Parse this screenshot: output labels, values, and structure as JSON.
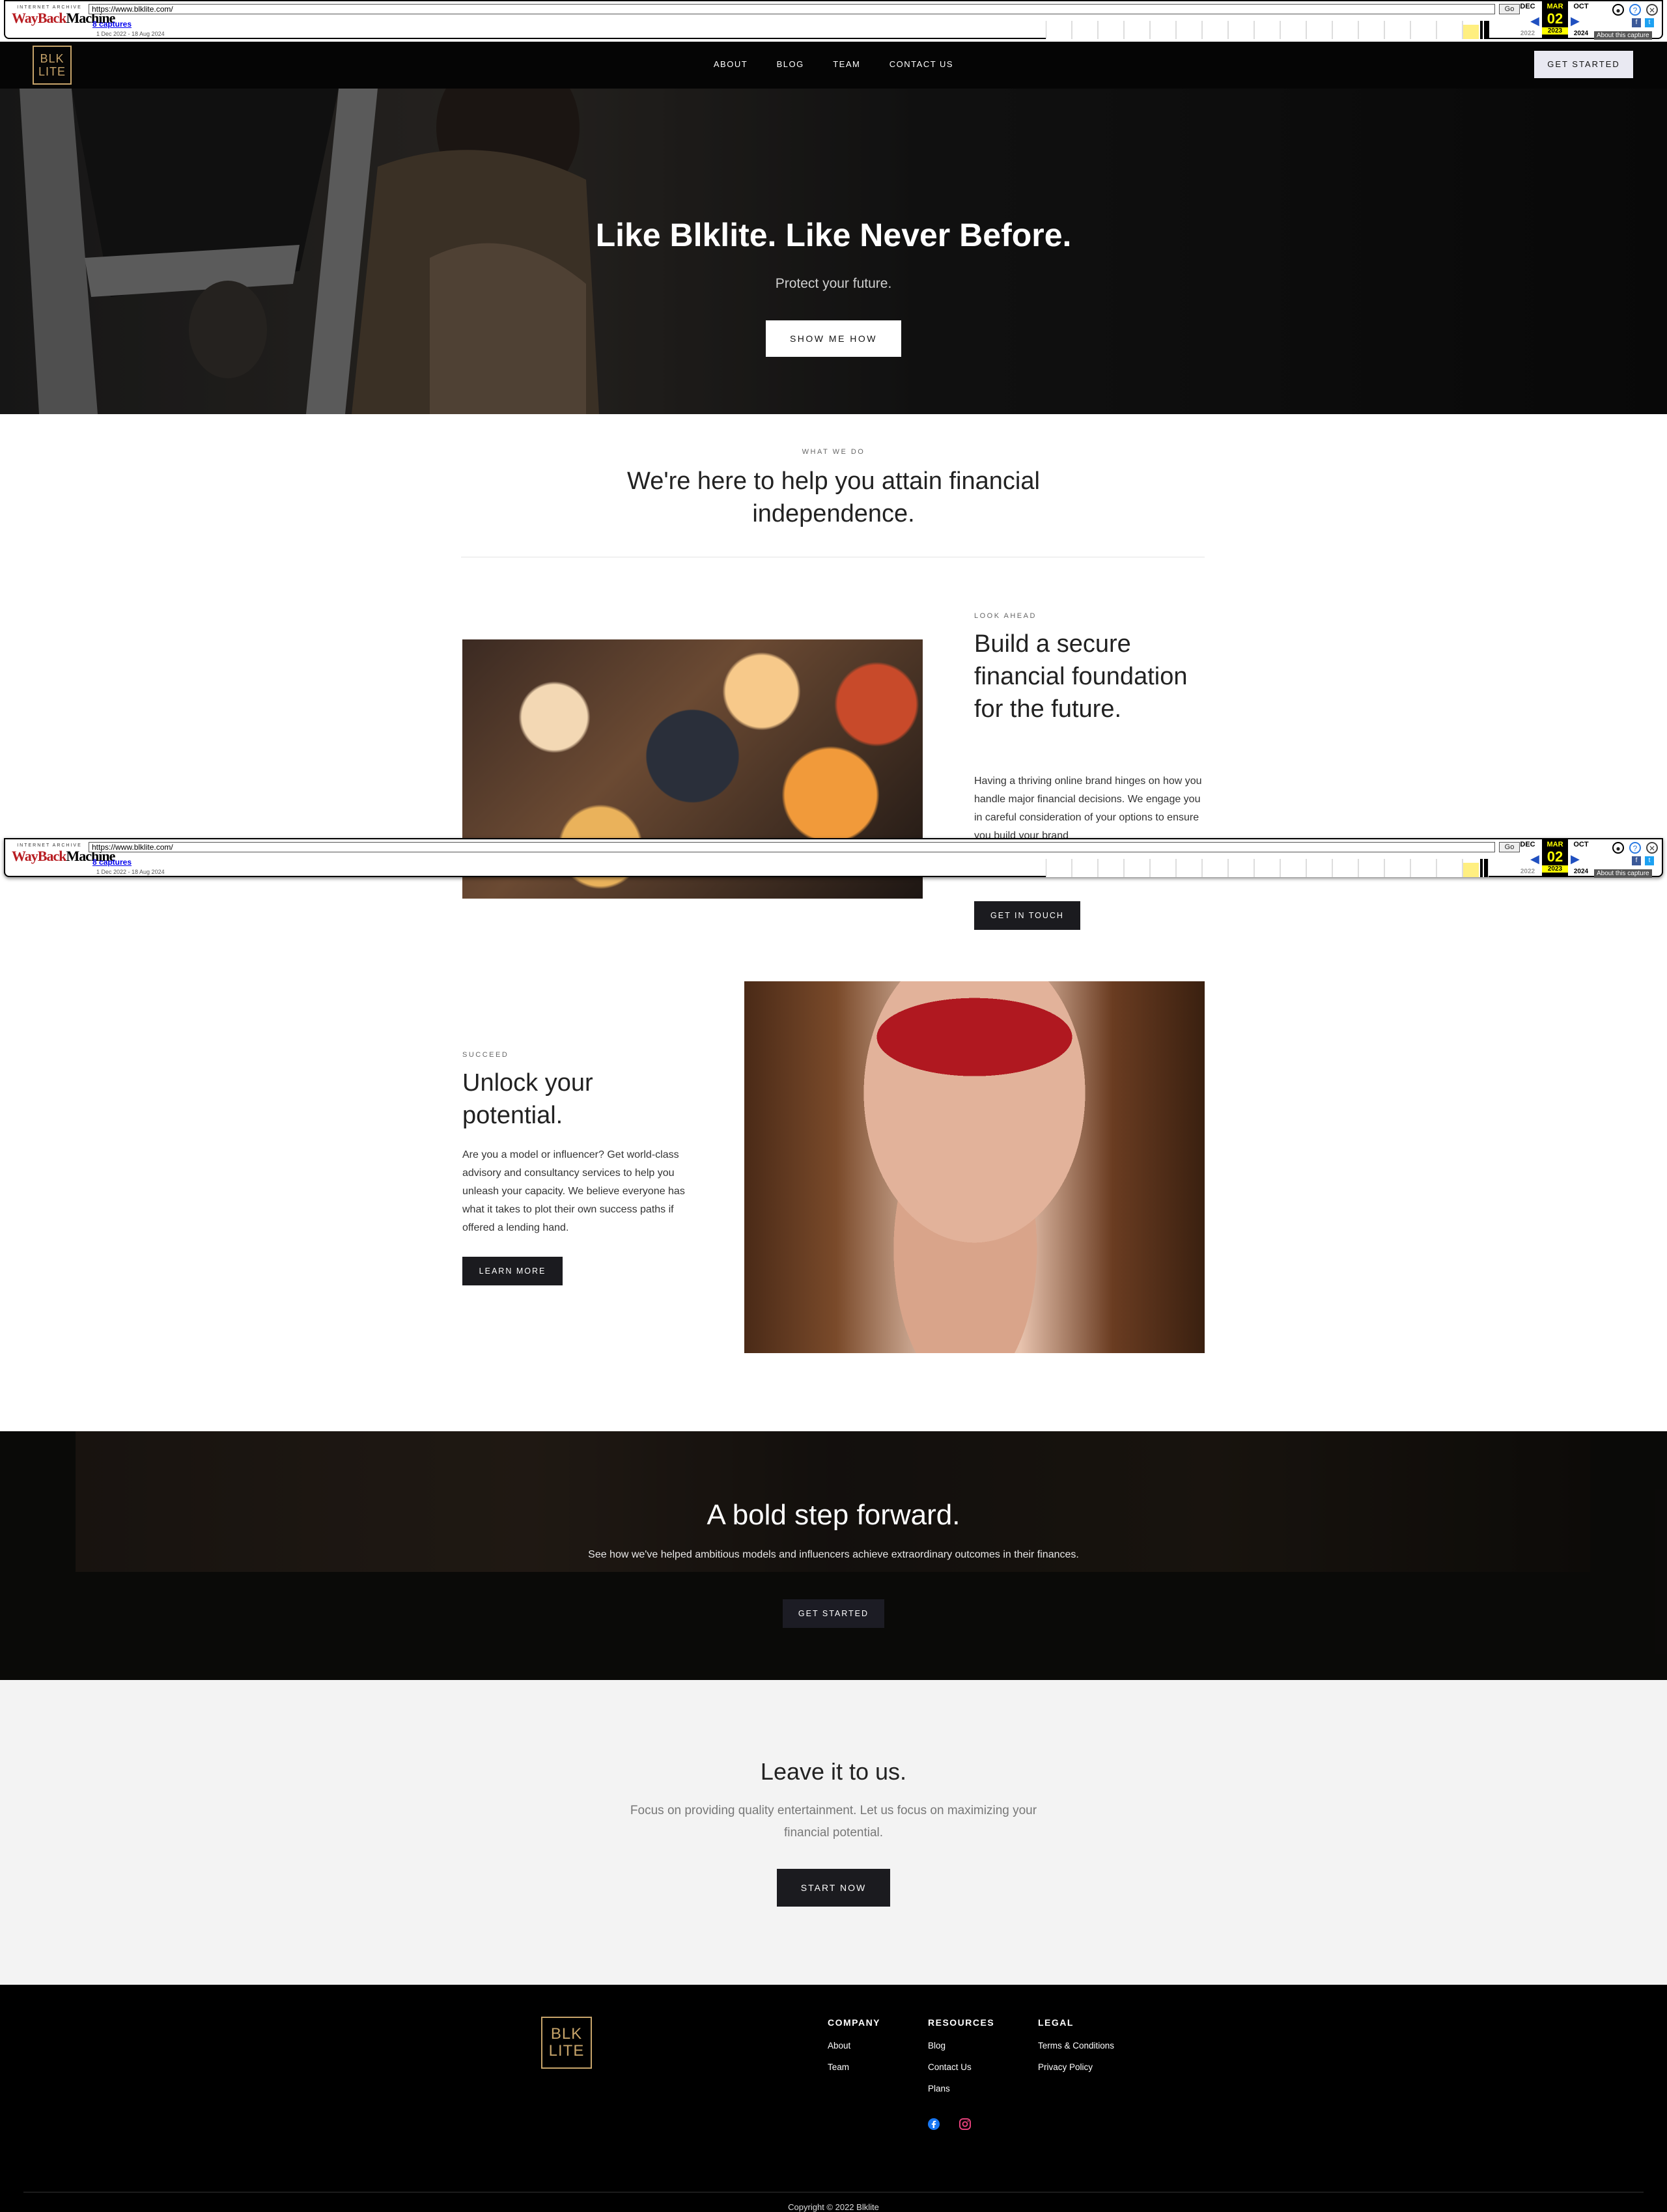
{
  "wayback": {
    "url": "https://www.blklite.com/",
    "go_label": "Go",
    "captures": "8 captures",
    "date_range": "1 Dec 2022 - 18 Aug 2024",
    "prev_month": "DEC",
    "cur_month": "MAR",
    "next_month": "OCT",
    "cur_day": "02",
    "prev_year": "2022",
    "cur_year": "2023",
    "next_year": "2024",
    "about": "About this capture",
    "brand_top": "INTERNET ARCHIVE",
    "brand_way": "WayBack",
    "brand_mach": "Machine"
  },
  "header": {
    "logo_line1": "BLK",
    "logo_line2": "LITE",
    "nav": [
      "ABOUT",
      "BLOG",
      "TEAM",
      "CONTACT US"
    ],
    "cta": "GET STARTED"
  },
  "hero": {
    "title": "Like Blklite. Like Never Before.",
    "subtitle": "Protect your future.",
    "button": "SHOW ME HOW"
  },
  "intro": {
    "eyebrow": "WHAT WE DO",
    "title": "We're here to help you attain financial independence."
  },
  "feature1": {
    "eyebrow": "LOOK AHEAD",
    "title": "Build a secure financial foundation for the future.",
    "body": "Having a thriving online brand hinges on how you handle major financial decisions. We engage you in careful consideration of your options to ensure you build your brand",
    "button": "GET IN TOUCH"
  },
  "feature2": {
    "eyebrow": "SUCCEED",
    "title": "Unlock your potential.",
    "body": "Are you a model or influencer? Get world-class advisory and consultancy services to help you unleash your capacity. We believe everyone has what it takes to plot their own success paths if offered a lending hand.",
    "button": "LEARN MORE"
  },
  "bold": {
    "title": "A bold step forward.",
    "body": "See how we've helped ambitious models and influencers achieve extraordinary outcomes in their finances.",
    "button": "GET STARTED"
  },
  "leave": {
    "title": "Leave it to us.",
    "body": "Focus on providing quality entertainment. Let us focus on maximizing your financial potential.",
    "button": "START NOW"
  },
  "footer": {
    "logo_line1": "BLK",
    "logo_line2": "LITE",
    "company": {
      "heading": "COMPANY",
      "links": [
        "About",
        "Team"
      ]
    },
    "resources": {
      "heading": "RESOURCES",
      "links": [
        "Blog",
        "Contact Us",
        "Plans"
      ]
    },
    "legal": {
      "heading": "LEGAL",
      "links": [
        "Terms & Conditions",
        "Privacy Policy"
      ]
    },
    "copyright": "Copyright © 2022 Blklite"
  }
}
